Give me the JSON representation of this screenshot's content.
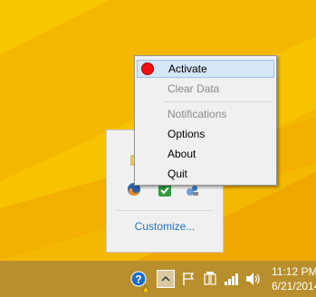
{
  "context_menu": {
    "items": [
      {
        "label": "Activate",
        "state": "highlighted",
        "icon": "red-dot-icon"
      },
      {
        "label": "Clear Data",
        "state": "disabled"
      },
      {
        "label": "Notifications",
        "state": "disabled"
      },
      {
        "label": "Options",
        "state": "enabled"
      },
      {
        "label": "About",
        "state": "enabled"
      },
      {
        "label": "Quit",
        "state": "enabled"
      }
    ]
  },
  "tray_flyout": {
    "customize_label": "Customize...",
    "icons": [
      "folder-icon",
      "firefox-icon",
      "green-check-icon",
      "network-user-icon"
    ]
  },
  "taskbar": {
    "tray_icons": [
      "help-icon",
      "show-hidden-icons-chevron",
      "action-center-flag-icon",
      "power-icon",
      "signal-icon",
      "volume-icon"
    ],
    "clock_time": "11:12 PM",
    "clock_date": "6/21/2014"
  },
  "colors": {
    "desktop": "#f5b800",
    "taskbar": "#b88f2c",
    "menu_background": "#f0f0f0",
    "menu_highlight": "#d5e6f7",
    "activate_dot": "#ee1111",
    "customize_link": "#1e73be"
  }
}
